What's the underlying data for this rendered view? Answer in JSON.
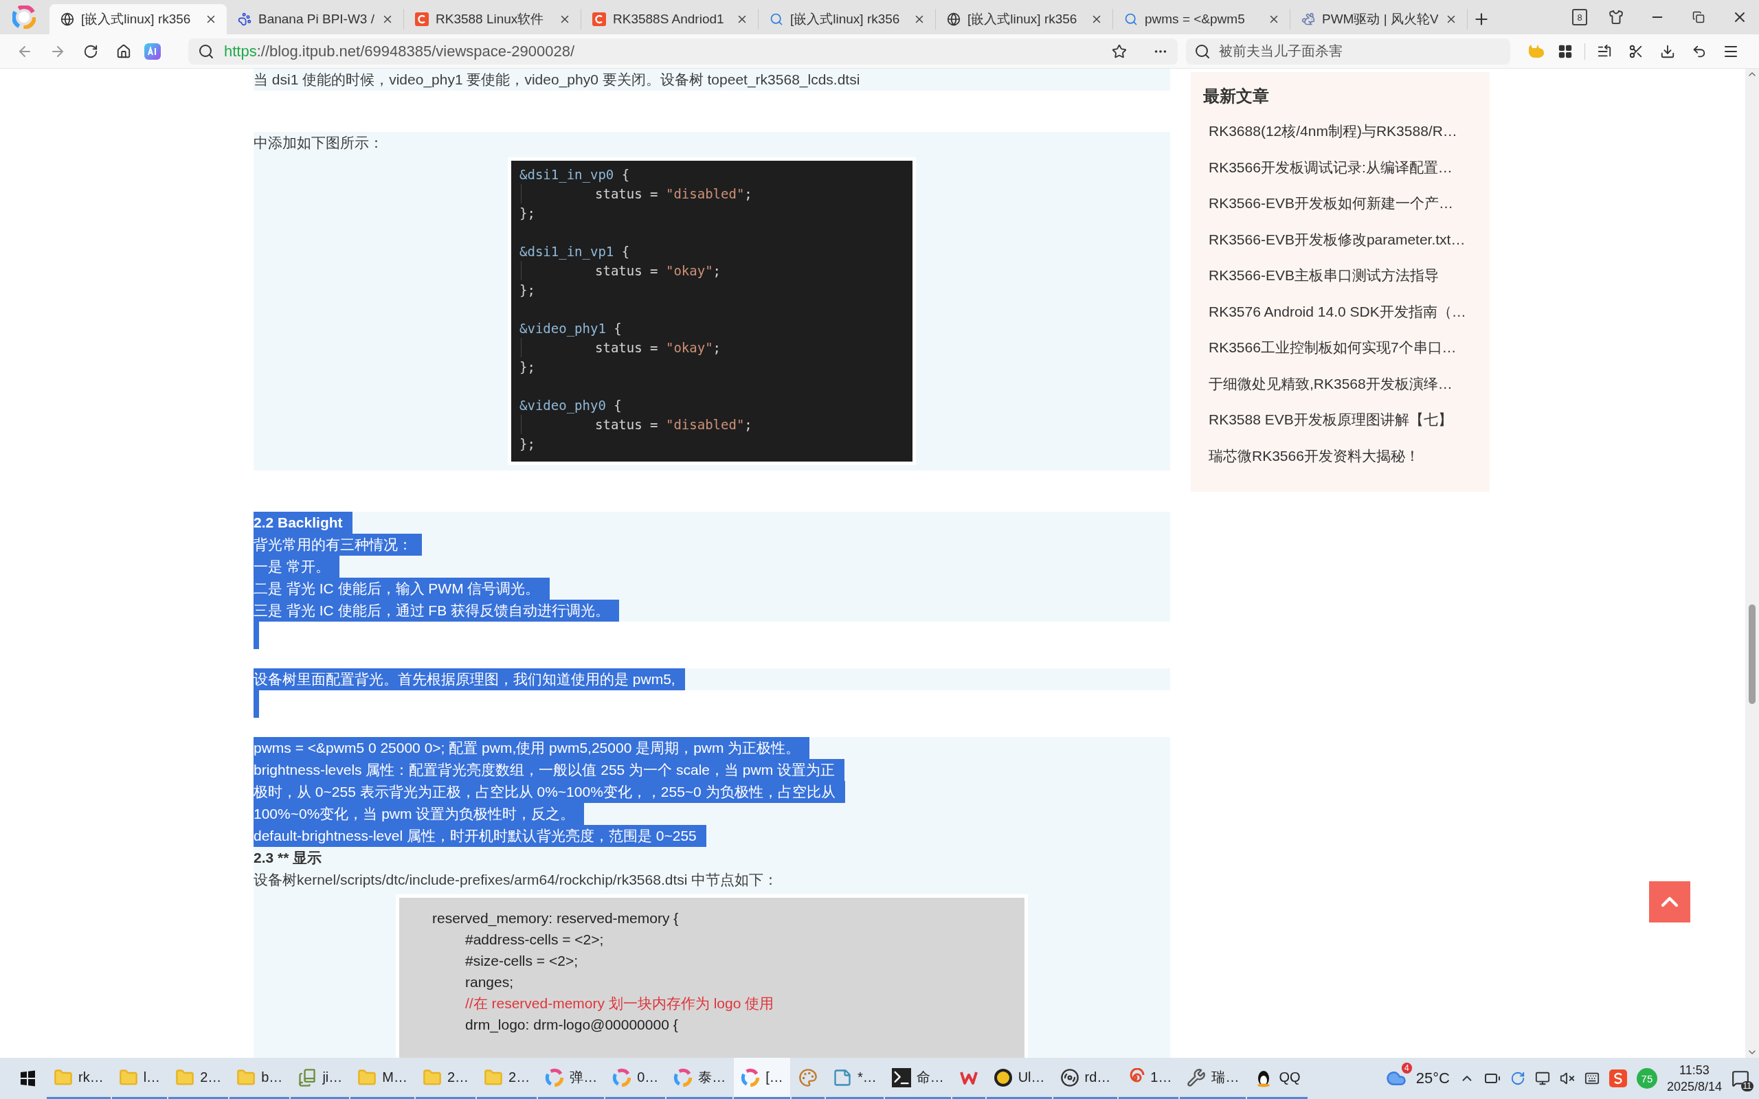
{
  "browser": {
    "tabs": [
      {
        "title": "[嵌入式linux] rk356",
        "selected": true
      },
      {
        "title": "Banana Pi BPI-W3 /",
        "selected": false
      },
      {
        "title": "RK3588 Linux软件",
        "selected": false
      },
      {
        "title": "RK3588S Andriod1",
        "selected": false
      },
      {
        "title": "[嵌入式linux] rk356",
        "selected": false
      },
      {
        "title": "[嵌入式linux] rk356",
        "selected": false
      },
      {
        "title": "pwms = <&pwm5",
        "selected": false
      },
      {
        "title": "PWM驱动 | 风火轮V",
        "selected": false
      }
    ],
    "tab_count": "8",
    "address": {
      "scheme": "https",
      "rest": "://blog.itpub.net/69948385/viewspace-2900028/"
    },
    "search": {
      "placeholder": "被前夫当儿子面杀害"
    }
  },
  "article": {
    "sections": [
      {
        "shaded": true,
        "items": [
          {
            "kind": "text",
            "text": "当 dsi1 使能的时候，video_phy1 要使能，video_phy0 要关闭。设备树 topeet_rk3568_lcds.dtsi",
            "highlighted": false
          }
        ]
      },
      {
        "shaded": true,
        "items": [
          {
            "kind": "text",
            "text": "中添加如下图所示：",
            "highlighted": false
          },
          {
            "kind": "dark_code",
            "blocks": [
              {
                "name": "&dsi1_in_vp0",
                "open": " {",
                "property": "status = ",
                "value": "\"disabled\"",
                "end": ";",
                "close": "};"
              },
              {
                "name": "&dsi1_in_vp1",
                "open": " {",
                "property": "status = ",
                "value": "\"okay\"",
                "end": ";",
                "close": "};"
              },
              {
                "name": "&video_phy1",
                "open": " {",
                "property": "status = ",
                "value": "\"okay\"",
                "end": ";",
                "close": "};"
              },
              {
                "name": "&video_phy0",
                "open": " {",
                "property": "status = ",
                "value": "\"disabled\"",
                "end": ";",
                "close": "};"
              }
            ]
          }
        ]
      },
      {
        "shaded": true,
        "items": [
          {
            "kind": "heading",
            "text": "2.2 Backlight",
            "highlighted": true
          },
          {
            "kind": "text",
            "text": "背光常用的有三种情况：",
            "highlighted": true
          },
          {
            "kind": "text",
            "text": "一是 常开。",
            "highlighted": true
          },
          {
            "kind": "text",
            "text": "二是 背光 IC 使能后，输入 PWM 信号调光。",
            "highlighted": true
          },
          {
            "kind": "text",
            "text": "三是 背光 IC 使能后，通过 FB 获得反馈自动进行调光。",
            "highlighted": true
          }
        ]
      },
      {
        "shaded": false,
        "items": [
          {
            "kind": "blank",
            "highlighted": true
          }
        ]
      },
      {
        "shaded": true,
        "items": [
          {
            "kind": "text",
            "text": "设备树里面配置背光。首先根据原理图，我们知道使用的是 pwm5,",
            "highlighted": true
          }
        ]
      },
      {
        "shaded": false,
        "items": [
          {
            "kind": "blank",
            "highlighted": true
          }
        ]
      },
      {
        "shaded": true,
        "items": [
          {
            "kind": "text",
            "text": "pwms = <&pwm5 0 25000 0>; 配置 pwm,使用 pwm5,25000 是周期，pwm 为正极性。",
            "highlighted": true
          },
          {
            "kind": "text",
            "text": "brightness-levels 属性：配置背光亮度数组，一般以值 255 为一个 scale，当 pwm 设置为正",
            "highlighted": true
          },
          {
            "kind": "text",
            "text": "极时，从 0~255 表示背光为正极，占空比从 0%~100%变化，，255~0 为负极性，占空比从",
            "highlighted": true
          },
          {
            "kind": "text",
            "text": "100%~0%变化，当 pwm 设置为负极性时，反之。",
            "highlighted": true
          },
          {
            "kind": "text",
            "text": "default-brightness-level 属性，时开机时默认背光亮度，范围是 0~255",
            "highlighted": true
          },
          {
            "kind": "heading",
            "text": "2.3 **  显示",
            "highlighted": false
          },
          {
            "kind": "text",
            "text": "设备树kernel/scripts/dtc/include-prefixes/arm64/rockchip/rk3568.dtsi 中节点如下：",
            "highlighted": false
          },
          {
            "kind": "light_code",
            "header": "reserved_memory: reserved-memory {",
            "children": [
              {
                "kind": "plain",
                "text": "#address-cells = <2>;"
              },
              {
                "kind": "plain",
                "text": "#size-cells = <2>;"
              },
              {
                "kind": "plain",
                "text": "ranges;"
              },
              {
                "kind": "comment",
                "text": "//在 reserved-memory 划一块内存作为 logo 使用"
              },
              {
                "kind": "plain",
                "text": "drm_logo: drm-logo@00000000 {"
              }
            ]
          }
        ]
      }
    ]
  },
  "sidebar": {
    "title": "最新文章",
    "items": [
      "RK3688(12核/4nm制程)与RK3588/R…",
      "RK3566开发板调试记录:从编译配置…",
      "RK3566-EVB开发板如何新建一个产…",
      "RK3566-EVB开发板修改parameter.txt…",
      "RK3566-EVB主板串口测试方法指导",
      "RK3576 Android 14.0 SDK开发指南（…",
      "RK3566工业控制板如何实现7个串口…",
      "于细微处见精致,RK3568开发板演绎…",
      "RK3588 EVB开发板原理图讲解【七】",
      "瑞芯微RK3566开发资料大揭秘！"
    ]
  },
  "taskbar": {
    "items": [
      {
        "label": "rk…",
        "selected": false
      },
      {
        "label": "l…",
        "selected": false
      },
      {
        "label": "2…",
        "selected": false
      },
      {
        "label": "b…",
        "selected": false
      },
      {
        "label": "ji…",
        "selected": false
      },
      {
        "label": "M…",
        "selected": false
      },
      {
        "label": "2…",
        "selected": false
      },
      {
        "label": "2…",
        "selected": false
      },
      {
        "label": "弹…",
        "selected": false
      },
      {
        "label": "0…",
        "selected": false
      },
      {
        "label": "泰…",
        "selected": false
      },
      {
        "label": "[…",
        "selected": true
      },
      {
        "selected": false
      },
      {
        "label": "*…",
        "selected": false
      },
      {
        "label": "命…",
        "selected": false
      },
      {
        "selected": false
      },
      {
        "label": "Ul…",
        "selected": false
      },
      {
        "label": "rd…",
        "selected": false
      },
      {
        "label": "1…",
        "selected": false
      },
      {
        "label": "瑞…",
        "selected": false
      },
      {
        "label": "QQ",
        "selected": false
      }
    ],
    "tray": {
      "weather_badge": "4",
      "temperature": "25°C",
      "security_badge": "75",
      "time": "11:53",
      "date": "2025/8/14",
      "notifications": "11"
    }
  }
}
